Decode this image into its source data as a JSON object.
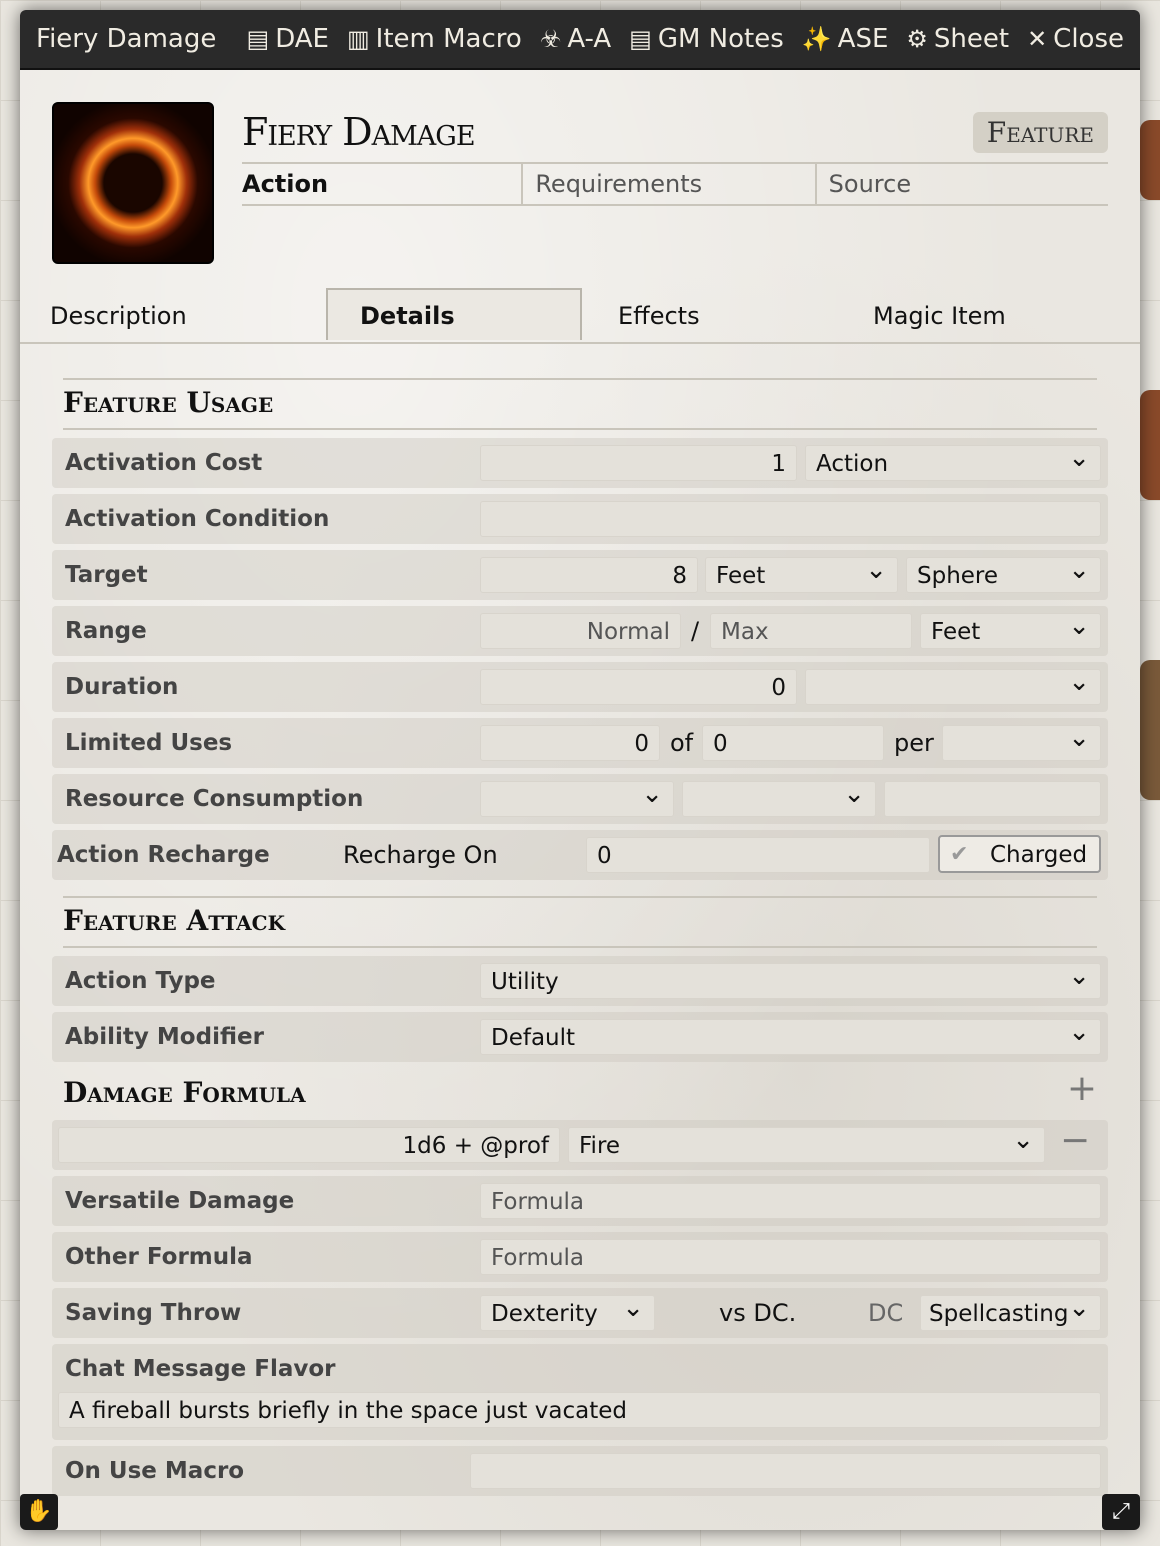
{
  "window": {
    "title": "Fiery Damage",
    "header_buttons": [
      {
        "icon": "clipboard-icon",
        "glyph": "▤",
        "label": "DAE"
      },
      {
        "icon": "scroll-icon",
        "glyph": "▥",
        "label": "Item Macro"
      },
      {
        "icon": "biohazard-icon",
        "glyph": "☣",
        "label": "A-A"
      },
      {
        "icon": "clipboard-icon",
        "glyph": "▤",
        "label": "GM Notes"
      },
      {
        "icon": "magic-wand-icon",
        "glyph": "✨",
        "label": "ASE"
      },
      {
        "icon": "gear-icon",
        "glyph": "⚙",
        "label": "Sheet"
      },
      {
        "icon": "close-icon",
        "glyph": "✕",
        "label": "Close"
      }
    ]
  },
  "item": {
    "name": "Fiery Damage",
    "type": "Feature",
    "summary": [
      "Action",
      "Requirements",
      "Source"
    ]
  },
  "tabs": [
    "Description",
    "Details",
    "Effects",
    "Magic Item"
  ],
  "active_tab": "Details",
  "feature_usage": {
    "heading": "Feature Usage",
    "activation_cost": {
      "label": "Activation Cost",
      "value": "1",
      "unit": "Action"
    },
    "activation_condition": {
      "label": "Activation Condition",
      "value": ""
    },
    "target": {
      "label": "Target",
      "value": "8",
      "unit": "Feet",
      "shape": "Sphere"
    },
    "range": {
      "label": "Range",
      "normal": "Normal",
      "slash": "/",
      "max": "Max",
      "unit": "Feet"
    },
    "duration": {
      "label": "Duration",
      "value": "0",
      "unit": ""
    },
    "limited_uses": {
      "label": "Limited Uses",
      "value": "0",
      "of": "of",
      "max": "0",
      "per": "per",
      "period": ""
    },
    "resource_consumption": {
      "label": "Resource Consumption",
      "type": "",
      "target": "",
      "amount": ""
    },
    "action_recharge": {
      "label": "Action Recharge",
      "recharge_on_label": "Recharge On",
      "value": "0",
      "charged_label": "Charged"
    }
  },
  "feature_attack": {
    "heading": "Feature Attack",
    "action_type": {
      "label": "Action Type",
      "value": "Utility"
    },
    "ability_modifier": {
      "label": "Ability Modifier",
      "value": "Default"
    }
  },
  "damage": {
    "heading": "Damage Formula",
    "add": "+",
    "parts": [
      {
        "formula": "1d6 + @prof",
        "type": "Fire",
        "remove": "−"
      }
    ],
    "versatile": {
      "label": "Versatile Damage",
      "placeholder": "Formula"
    },
    "other": {
      "label": "Other Formula",
      "placeholder": "Formula"
    },
    "saving_throw": {
      "label": "Saving Throw",
      "ability": "Dexterity",
      "vs": "vs DC.",
      "dc": "DC",
      "scaling": "Spellcasting"
    },
    "chat_flavor": {
      "label": "Chat Message Flavor",
      "value": "A fireball bursts briefly in the space just vacated"
    },
    "on_use_macro": {
      "label": "On Use Macro",
      "value": ""
    }
  }
}
